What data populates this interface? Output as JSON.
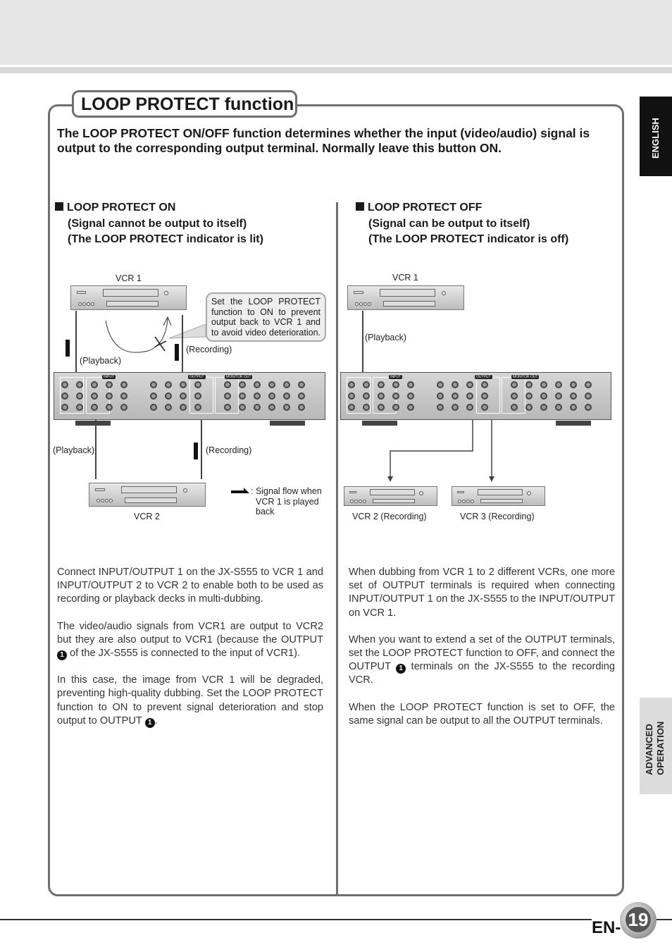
{
  "title": "LOOP PROTECT function",
  "intro": "The LOOP PROTECT ON/OFF function determines whether the input (video/audio) signal is output to the corresponding output terminal. Normally leave this button ON.",
  "tabs": {
    "language": "ENGLISH",
    "section_line1": "ADVANCED",
    "section_line2": "OPERATION"
  },
  "left": {
    "heading": "LOOP PROTECT ON",
    "sub1": "(Signal cannot be output to itself)",
    "sub2": "(The LOOP PROTECT indicator is lit)",
    "diagram": {
      "vcr1": "VCR 1",
      "vcr2": "VCR 2",
      "playback_top": "(Playback)",
      "recording_top": "(Recording)",
      "playback_bottom": "(Playback)",
      "recording_bottom": "(Recording)",
      "callout": "Set the LOOP PROTECT function to ON to prevent output back to VCR 1 and to avoid video deterioration.",
      "legend_line1": ": Signal flow when",
      "legend_line2": "VCR 1 is played",
      "legend_line3": "back",
      "panel_labels": [
        "INPUT",
        "OUTPUT",
        "MONITOR OUT"
      ]
    },
    "paragraphs": [
      "Connect INPUT/OUTPUT 1 on the JX-S555 to VCR 1 and INPUT/OUTPUT 2 to VCR 2 to enable both to be used as recording or playback decks in multi-dubbing.",
      [
        "The video/audio signals from VCR1 are output to VCR2 but they are also output to VCR1 (because the OUTPUT ",
        "1",
        " of the JX-S555 is connected to the input of VCR1)."
      ],
      [
        "In this case, the image from VCR 1 will be degraded, preventing high-quality dubbing.  Set the LOOP PROTECT function to ON to prevent signal deterioration and stop output to OUTPUT ",
        "1",
        "."
      ]
    ]
  },
  "right": {
    "heading": "LOOP PROTECT OFF",
    "sub1": "(Signal can be output to itself)",
    "sub2": "(The LOOP PROTECT indicator is off)",
    "diagram": {
      "vcr1": "VCR 1",
      "playback": "(Playback)",
      "vcr2": "VCR 2 (Recording)",
      "vcr3": "VCR 3 (Recording)",
      "panel_labels": [
        "INPUT",
        "OUTPUT",
        "MONITOR OUT"
      ]
    },
    "paragraphs": [
      "When dubbing from VCR 1 to 2 different VCRs, one more set of OUTPUT terminals is required when connecting INPUT/OUTPUT 1 on the JX-S555 to the INPUT/OUTPUT on VCR 1.",
      [
        "When you want to extend a set of the OUTPUT terminals, set the LOOP PROTECT function to OFF, and connect the OUTPUT ",
        "1",
        " terminals on the JX-S555 to the recording VCR."
      ],
      "When the LOOP PROTECT function is set to OFF, the same signal can be output to all the OUTPUT terminals."
    ]
  },
  "footer": {
    "prefix": "EN-",
    "page": "19"
  }
}
